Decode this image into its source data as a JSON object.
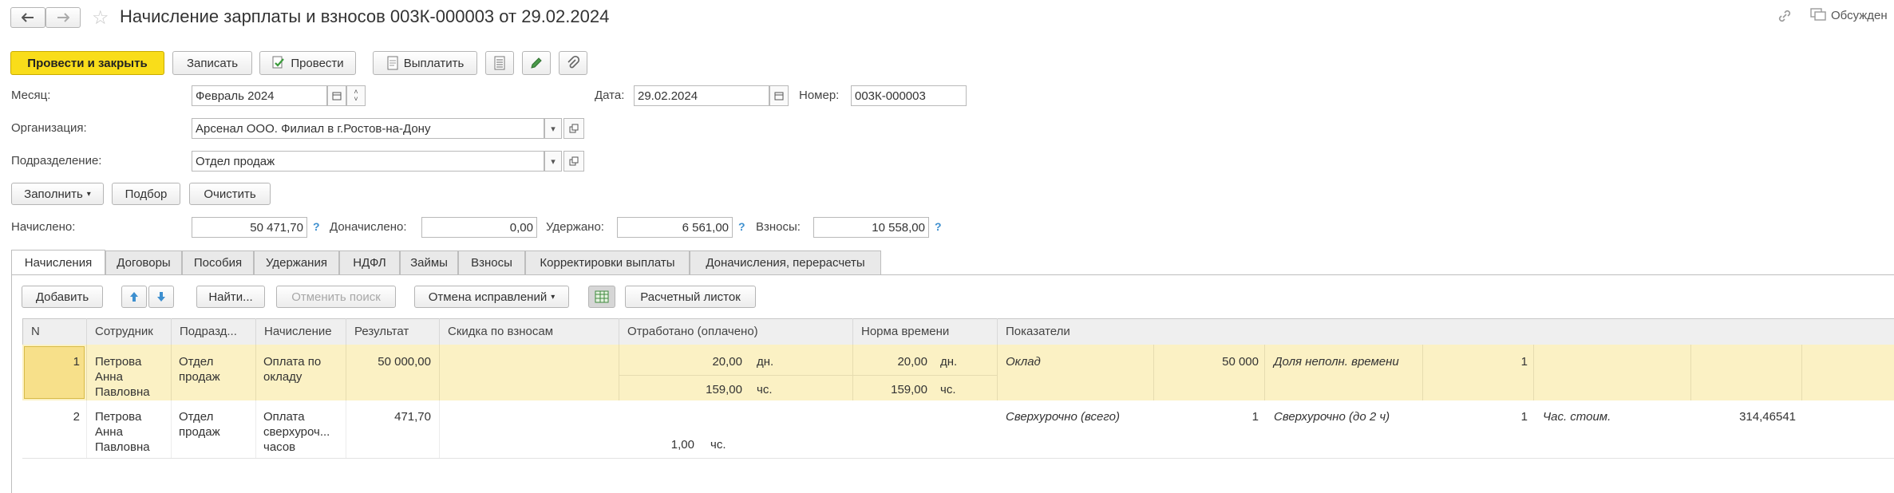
{
  "title": "Начисление зарплаты и взносов 003К-000003 от 29.02.2024",
  "topright": {
    "discussions": "Обсужден"
  },
  "toolbar": {
    "post_close": "Провести и закрыть",
    "save": "Записать",
    "post": "Провести",
    "pay": "Выплатить"
  },
  "form": {
    "month_label": "Месяц:",
    "month_value": "Февраль 2024",
    "date_label": "Дата:",
    "date_value": "29.02.2024",
    "number_label": "Номер:",
    "number_value": "003К-000003",
    "org_label": "Организация:",
    "org_value": "Арсенал ООО. Филиал в г.Ростов-на-Дону",
    "dept_label": "Подразделение:",
    "dept_value": "Отдел продаж"
  },
  "actions": {
    "fill": "Заполнить",
    "select": "Подбор",
    "clear": "Очистить"
  },
  "totals": {
    "accrued_label": "Начислено:",
    "accrued_value": "50 471,70",
    "extra_label": "Доначислено:",
    "extra_value": "0,00",
    "withheld_label": "Удержано:",
    "withheld_value": "6 561,00",
    "contrib_label": "Взносы:",
    "contrib_value": "10 558,00",
    "help": "?"
  },
  "tabs": [
    "Начисления",
    "Договоры",
    "Пособия",
    "Удержания",
    "НДФЛ",
    "Займы",
    "Взносы",
    "Корректировки выплаты",
    "Доначисления, перерасчеты"
  ],
  "grid_toolbar": {
    "add": "Добавить",
    "find": "Найти...",
    "cancel_search": "Отменить поиск",
    "cancel_fixes": "Отмена исправлений",
    "payslip": "Расчетный листок"
  },
  "columns": [
    "N",
    "Сотрудник",
    "Подразд...",
    "Начисление",
    "Результат",
    "Скидка по взносам",
    "Отработано (оплачено)",
    "Норма времени",
    "Показатели"
  ],
  "rows": [
    {
      "n": "1",
      "employee": [
        "Петрова",
        "Анна",
        "Павловна"
      ],
      "dept": [
        "Отдел",
        "продаж"
      ],
      "accrual": [
        "Оплата по",
        "окладу"
      ],
      "result": "50 000,00",
      "worked1": "20,00",
      "worked1_unit": "дн.",
      "worked2": "159,00",
      "worked2_unit": "чс.",
      "norm1": "20,00",
      "norm1_unit": "дн.",
      "norm2": "159,00",
      "norm2_unit": "чс.",
      "ind1_name": "Оклад",
      "ind1_value": "50 000",
      "ind2_name": "Доля неполн. времени",
      "ind2_value": "1"
    },
    {
      "n": "2",
      "employee": [
        "Петрова",
        "Анна",
        "Павловна"
      ],
      "dept": [
        "Отдел",
        "продаж"
      ],
      "accrual": [
        "Оплата",
        "сверхуроч...",
        "часов"
      ],
      "result": "471,70",
      "worked": "1,00",
      "worked_unit": "чс.",
      "ind1_name": "Сверхурочно (всего)",
      "ind1_value": "1",
      "ind2_name": "Сверхурочно (до 2 ч)",
      "ind2_value": "1",
      "ind3_name": "Час. стоим.",
      "ind3_value": "314,46541"
    }
  ],
  "colors": {
    "primary": "#f9dd1a",
    "selected_row": "#fbf1c4",
    "selected_cell": "#f7e08a",
    "help": "#3d8fcf"
  }
}
